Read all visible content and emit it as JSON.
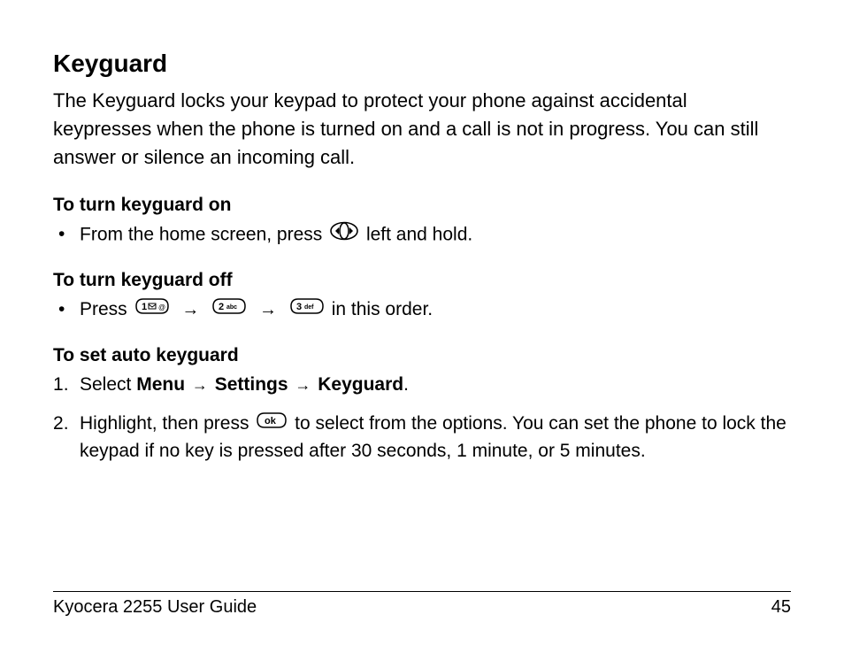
{
  "title": "Keyguard",
  "intro": "The Keyguard locks your keypad to protect your phone against accidental keypresses when the phone is turned on and a call is not in progress. You can still answer or silence an incoming call.",
  "section_on": {
    "heading": "To turn keyguard on",
    "text_before": "From the home screen, press ",
    "text_after": " left and hold."
  },
  "section_off": {
    "heading": "To turn keyguard off",
    "text_before": "Press ",
    "text_after": " in this order."
  },
  "section_auto": {
    "heading": "To set auto keyguard",
    "step1_prefix": "Select ",
    "step1_menu": "Menu",
    "step1_settings": "Settings",
    "step1_keyguard": "Keyguard",
    "step1_suffix": ".",
    "step2_before": "Highlight, then press ",
    "step2_after": " to select from the options. You can set the phone to lock the keypad if no key is pressed after 30 seconds, 1 minute, or 5 minutes."
  },
  "arrow": "→",
  "footer": {
    "guide": "Kyocera 2255 User Guide",
    "page": "45"
  }
}
